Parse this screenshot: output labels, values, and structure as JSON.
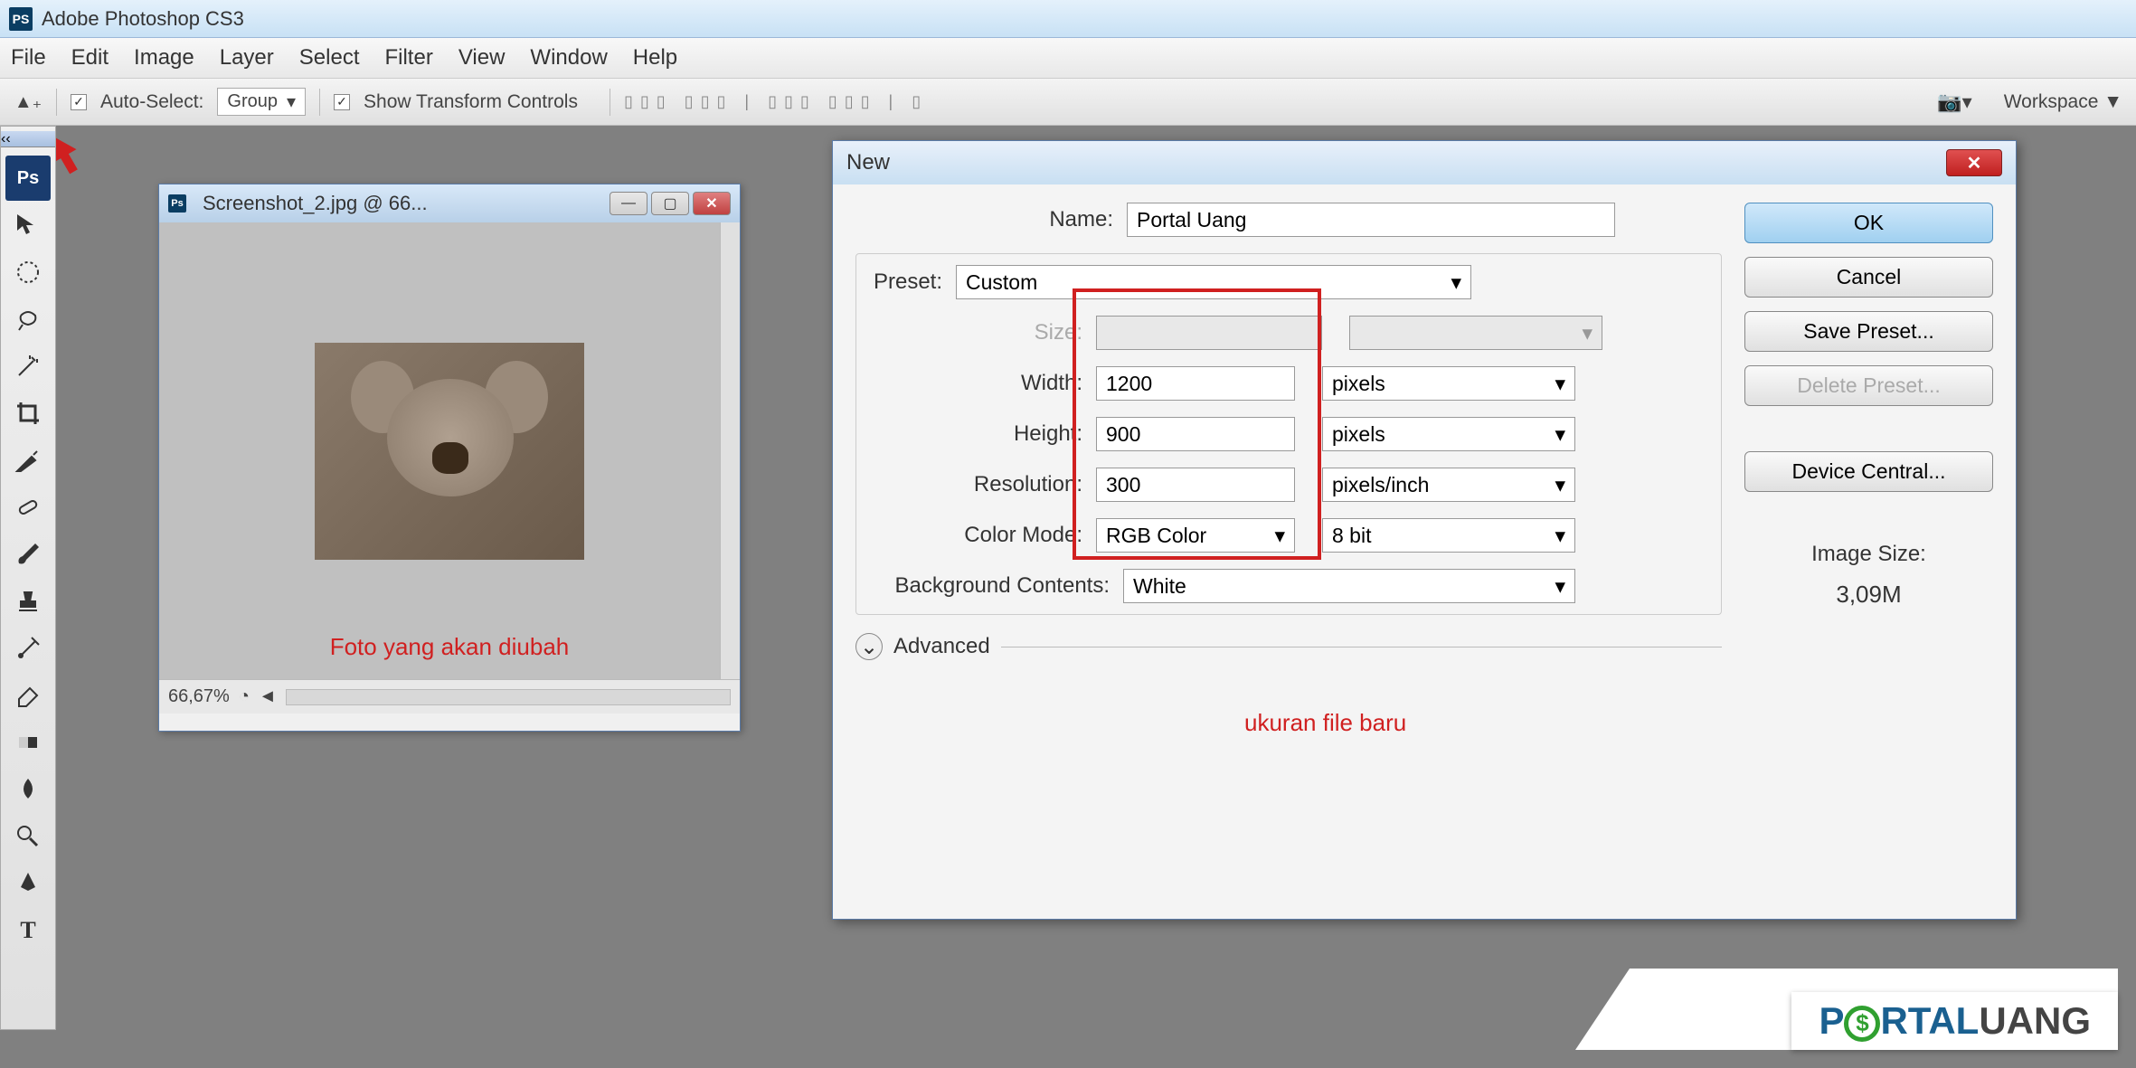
{
  "app": {
    "title": "Adobe Photoshop CS3",
    "badge": "PS"
  },
  "menu": [
    "File",
    "Edit",
    "Image",
    "Layer",
    "Select",
    "Filter",
    "View",
    "Window",
    "Help"
  ],
  "options": {
    "autoselect": "Auto-Select:",
    "group": "Group",
    "transform": "Show Transform Controls",
    "workspace": "Workspace ▼"
  },
  "doc": {
    "title": "Screenshot_2.jpg @ 66...",
    "caption": "Foto yang akan diubah",
    "zoom": "66,67%"
  },
  "dialog": {
    "title": "New",
    "name_label": "Name:",
    "name_value": "Portal Uang",
    "preset_label": "Preset:",
    "preset_value": "Custom",
    "size_label": "Size:",
    "width_label": "Width:",
    "width_value": "1200",
    "width_unit": "pixels",
    "height_label": "Height:",
    "height_value": "900",
    "height_unit": "pixels",
    "resolution_label": "Resolution:",
    "resolution_value": "300",
    "resolution_unit": "pixels/inch",
    "colormode_label": "Color Mode:",
    "colormode_value": "RGB Color",
    "colormode_depth": "8 bit",
    "bg_label": "Background Contents:",
    "bg_value": "White",
    "advanced": "Advanced",
    "anno": "ukuran file baru",
    "imagesize_label": "Image Size:",
    "imagesize_value": "3,09M",
    "btn_ok": "OK",
    "btn_cancel": "Cancel",
    "btn_save": "Save Preset...",
    "btn_delete": "Delete Preset...",
    "btn_device": "Device Central..."
  },
  "watermark": {
    "portal": "P",
    "o": "$",
    "rtal": "RTAL",
    "uang": "UANG"
  }
}
